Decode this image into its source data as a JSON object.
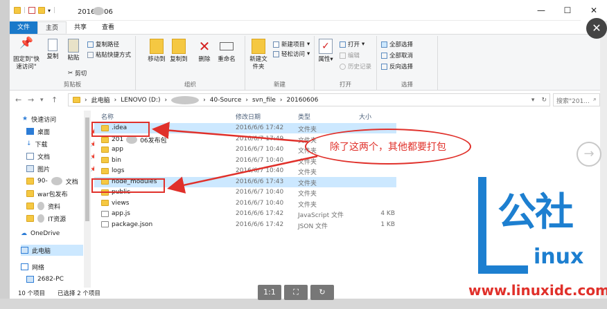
{
  "window": {
    "title": "20160606"
  },
  "ribbon_tabs": [
    "文件",
    "主页",
    "共享",
    "查看"
  ],
  "ribbon": {
    "clipboard": {
      "pin_label": "固定到\"快速访问\"",
      "copy_label": "复制",
      "paste_label": "粘贴",
      "copy_path": "复制路径",
      "paste_shortcut": "粘贴快捷方式",
      "cut": "剪切",
      "title": "剪贴板"
    },
    "organize": {
      "move_to": "移动到",
      "copy_to": "复制到",
      "delete": "删除",
      "rename": "重命名",
      "title": "组织"
    },
    "new": {
      "new_folder": "新建文件夹",
      "new_item": "新建项目",
      "easy_access": "轻松访问",
      "title": "新建"
    },
    "open": {
      "properties": "属性",
      "open": "打开",
      "edit": "编辑",
      "history": "历史记录",
      "title": "打开"
    },
    "select": {
      "select_all": "全部选择",
      "select_none": "全部取消",
      "invert": "反向选择",
      "title": "选择"
    }
  },
  "address": {
    "crumbs": [
      "此电脑",
      "LENOVO (D:)",
      "40-Source",
      "svn_file",
      "20160606"
    ],
    "search_placeholder": "搜索\"201..."
  },
  "nav": {
    "quick_access": "快速访问",
    "desktop": "桌面",
    "downloads": "下载",
    "documents": "文档",
    "pictures": "图片",
    "folder_90": "90-",
    "folder_90_suffix": "文档",
    "war_release": "war包发布",
    "materials": "资料",
    "it_resources": "IT资源",
    "onedrive": "OneDrive",
    "this_pc": "此电脑",
    "network": "网络",
    "pc_name": "2682-PC"
  },
  "columns": {
    "name": "名称",
    "date": "修改日期",
    "type": "类型",
    "size": "大小"
  },
  "files": [
    {
      "name": ".idea",
      "date": "2016/6/6 17:42",
      "type": "文件夹",
      "size": "",
      "selected": true
    },
    {
      "name": "201",
      "name_suffix": "06发布包",
      "date": "2016/6/7 17:49",
      "type": "文件夹",
      "size": "",
      "selected": false
    },
    {
      "name": "app",
      "date": "2016/6/7 10:40",
      "type": "文件夹",
      "size": "",
      "selected": false
    },
    {
      "name": "bin",
      "date": "2016/6/7 10:40",
      "type": "文件夹",
      "size": "",
      "selected": false
    },
    {
      "name": "logs",
      "date": "2016/6/7 10:40",
      "type": "文件夹",
      "size": "",
      "selected": false
    },
    {
      "name": "node_modules",
      "date": "2016/6/6 17:43",
      "type": "文件夹",
      "size": "",
      "selected": true
    },
    {
      "name": "public",
      "date": "2016/6/7 10:40",
      "type": "文件夹",
      "size": "",
      "selected": false
    },
    {
      "name": "views",
      "date": "2016/6/7 10:40",
      "type": "文件夹",
      "size": "",
      "selected": false
    },
    {
      "name": "app.js",
      "date": "2016/6/6 17:42",
      "type": "JavaScript 文件",
      "size": "4 KB",
      "selected": false
    },
    {
      "name": "package.json",
      "date": "2016/6/6 17:42",
      "type": "JSON 文件",
      "size": "1 KB",
      "selected": false
    }
  ],
  "annotation": {
    "text": "除了这两个，其他都要打包"
  },
  "status": {
    "items": "10 个项目",
    "selected": "已选择 2 个项目"
  },
  "viewer": {
    "ratio": "1:1"
  },
  "watermark": {
    "brand": "公社",
    "inux": "inux",
    "url": "www.linuxidc.com"
  },
  "colors": {
    "accent": "#1979ca",
    "selection": "#cce8ff",
    "annotation": "#e0302a",
    "watermark": "#1d7fd0"
  }
}
